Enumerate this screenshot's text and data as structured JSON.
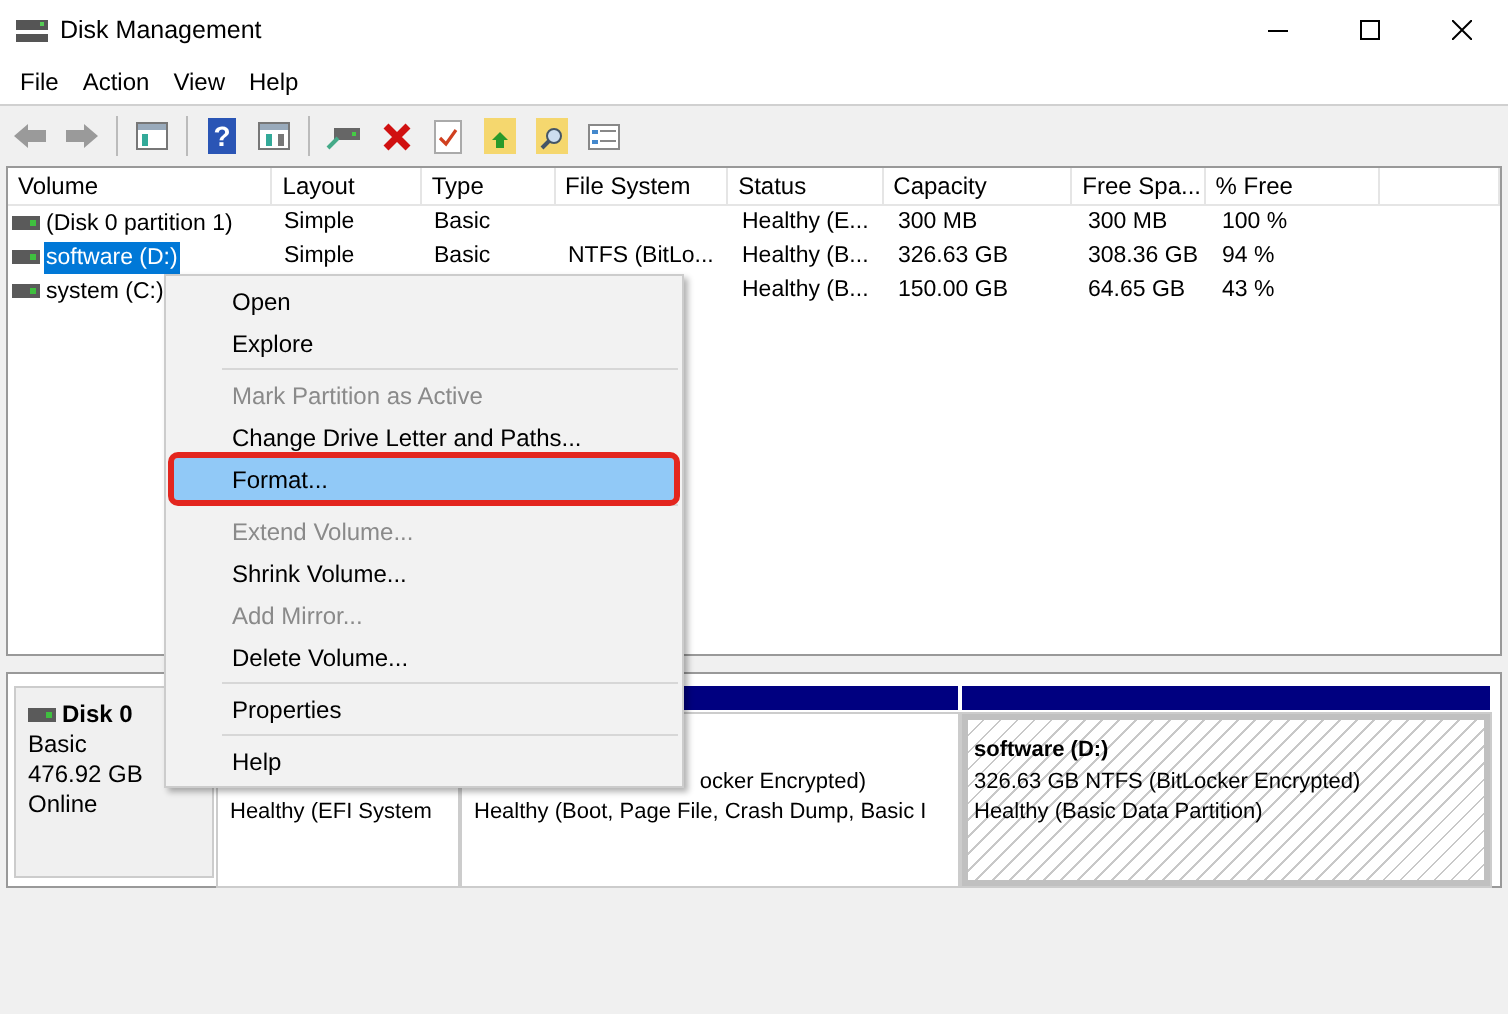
{
  "window": {
    "title": "Disk Management"
  },
  "menu_bar": [
    "File",
    "Action",
    "View",
    "Help"
  ],
  "toolbar": {
    "help_glyph": "?"
  },
  "table": {
    "columns": [
      "Volume",
      "Layout",
      "Type",
      "File System",
      "Status",
      "Capacity",
      "Free Spa...",
      "% Free"
    ],
    "rows": [
      {
        "selected": false,
        "cells": [
          "(Disk 0 partition 1)",
          "Simple",
          "Basic",
          "",
          "Healthy (E...",
          "300 MB",
          "300 MB",
          "100 %"
        ]
      },
      {
        "selected": true,
        "cells": [
          "software (D:)",
          "Simple",
          "Basic",
          "NTFS (BitLo...",
          "Healthy (B...",
          "326.63 GB",
          "308.36 GB",
          "94 %"
        ]
      },
      {
        "selected": false,
        "cells": [
          "system (C:)",
          "",
          "",
          "",
          "Healthy (B...",
          "150.00 GB",
          "64.65 GB",
          "43 %"
        ]
      }
    ]
  },
  "disk": {
    "name": "Disk 0",
    "type": "Basic",
    "size": "476.92 GB",
    "state": "Online",
    "partitions": [
      {
        "selected": false,
        "status": "Healthy (EFI System"
      },
      {
        "selected": false,
        "detail": "ocker Encrypted)",
        "status": "Healthy (Boot, Page File, Crash Dump, Basic I"
      },
      {
        "selected": true,
        "name": "software  (D:)",
        "detail": "326.63 GB NTFS (BitLocker Encrypted)",
        "status": "Healthy (Basic Data Partition)"
      }
    ]
  },
  "context_menu": [
    {
      "kind": "item",
      "label": "Open",
      "disabled": false,
      "highlighted": false
    },
    {
      "kind": "item",
      "label": "Explore",
      "disabled": false,
      "highlighted": false
    },
    {
      "kind": "separator"
    },
    {
      "kind": "item",
      "label": "Mark Partition as Active",
      "disabled": true,
      "highlighted": false
    },
    {
      "kind": "item",
      "label": "Change Drive Letter and Paths...",
      "disabled": false,
      "highlighted": false
    },
    {
      "kind": "item",
      "label": "Format...",
      "disabled": false,
      "highlighted": true
    },
    {
      "kind": "separator"
    },
    {
      "kind": "item",
      "label": "Extend Volume...",
      "disabled": true,
      "highlighted": false
    },
    {
      "kind": "item",
      "label": "Shrink Volume...",
      "disabled": false,
      "highlighted": false
    },
    {
      "kind": "item",
      "label": "Add Mirror...",
      "disabled": true,
      "highlighted": false
    },
    {
      "kind": "item",
      "label": "Delete Volume...",
      "disabled": false,
      "highlighted": false
    },
    {
      "kind": "separator"
    },
    {
      "kind": "item",
      "label": "Properties",
      "disabled": false,
      "highlighted": false
    },
    {
      "kind": "separator"
    },
    {
      "kind": "item",
      "label": "Help",
      "disabled": false,
      "highlighted": false
    }
  ]
}
